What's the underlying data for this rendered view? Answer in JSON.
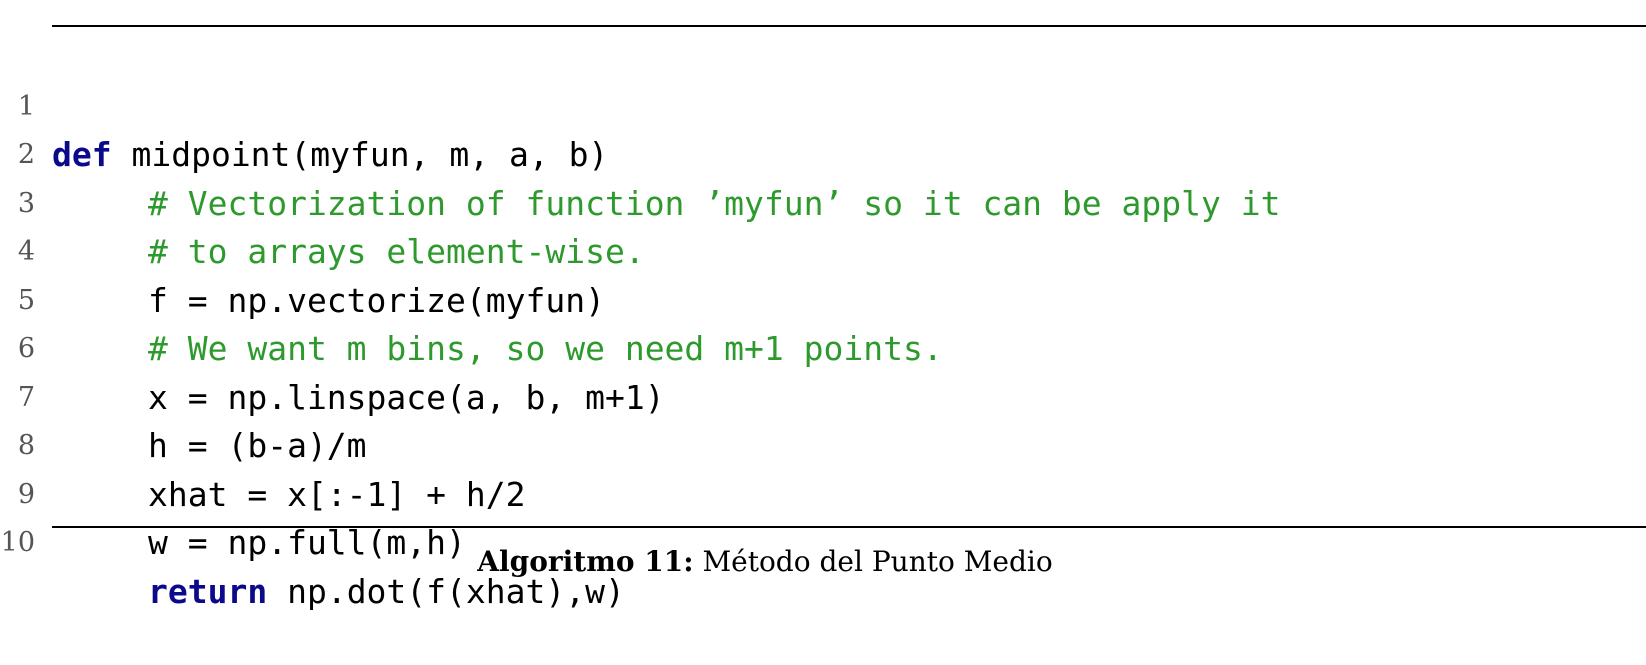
{
  "code": {
    "lines": [
      {
        "num": "1",
        "keyword": "def",
        "text": " midpoint(myfun, m, a, b)"
      },
      {
        "num": "2",
        "comment": "# Vectorization of function ’myfun’ so it can be apply it"
      },
      {
        "num": "3",
        "comment": "# to arrays element-wise."
      },
      {
        "num": "4",
        "text": "f = np.vectorize(myfun)"
      },
      {
        "num": "5",
        "comment": "# We want m bins, so we need m+1 points."
      },
      {
        "num": "6",
        "text": "x = np.linspace(a, b, m+1)"
      },
      {
        "num": "7",
        "text": "h = (b-a)/m"
      },
      {
        "num": "8",
        "text": "xhat = x[:-1] + h/2"
      },
      {
        "num": "9",
        "text": "w = np.full(m,h)"
      },
      {
        "num": "10",
        "keyword": "return",
        "text": " np.dot(f(xhat),w)"
      }
    ]
  },
  "caption": {
    "label": "Algoritmo 11:",
    "text": " Método del Punto Medio"
  },
  "colors": {
    "keyword": "#0c0a8a",
    "comment": "#2e9a2e",
    "line_number": "#555555"
  }
}
